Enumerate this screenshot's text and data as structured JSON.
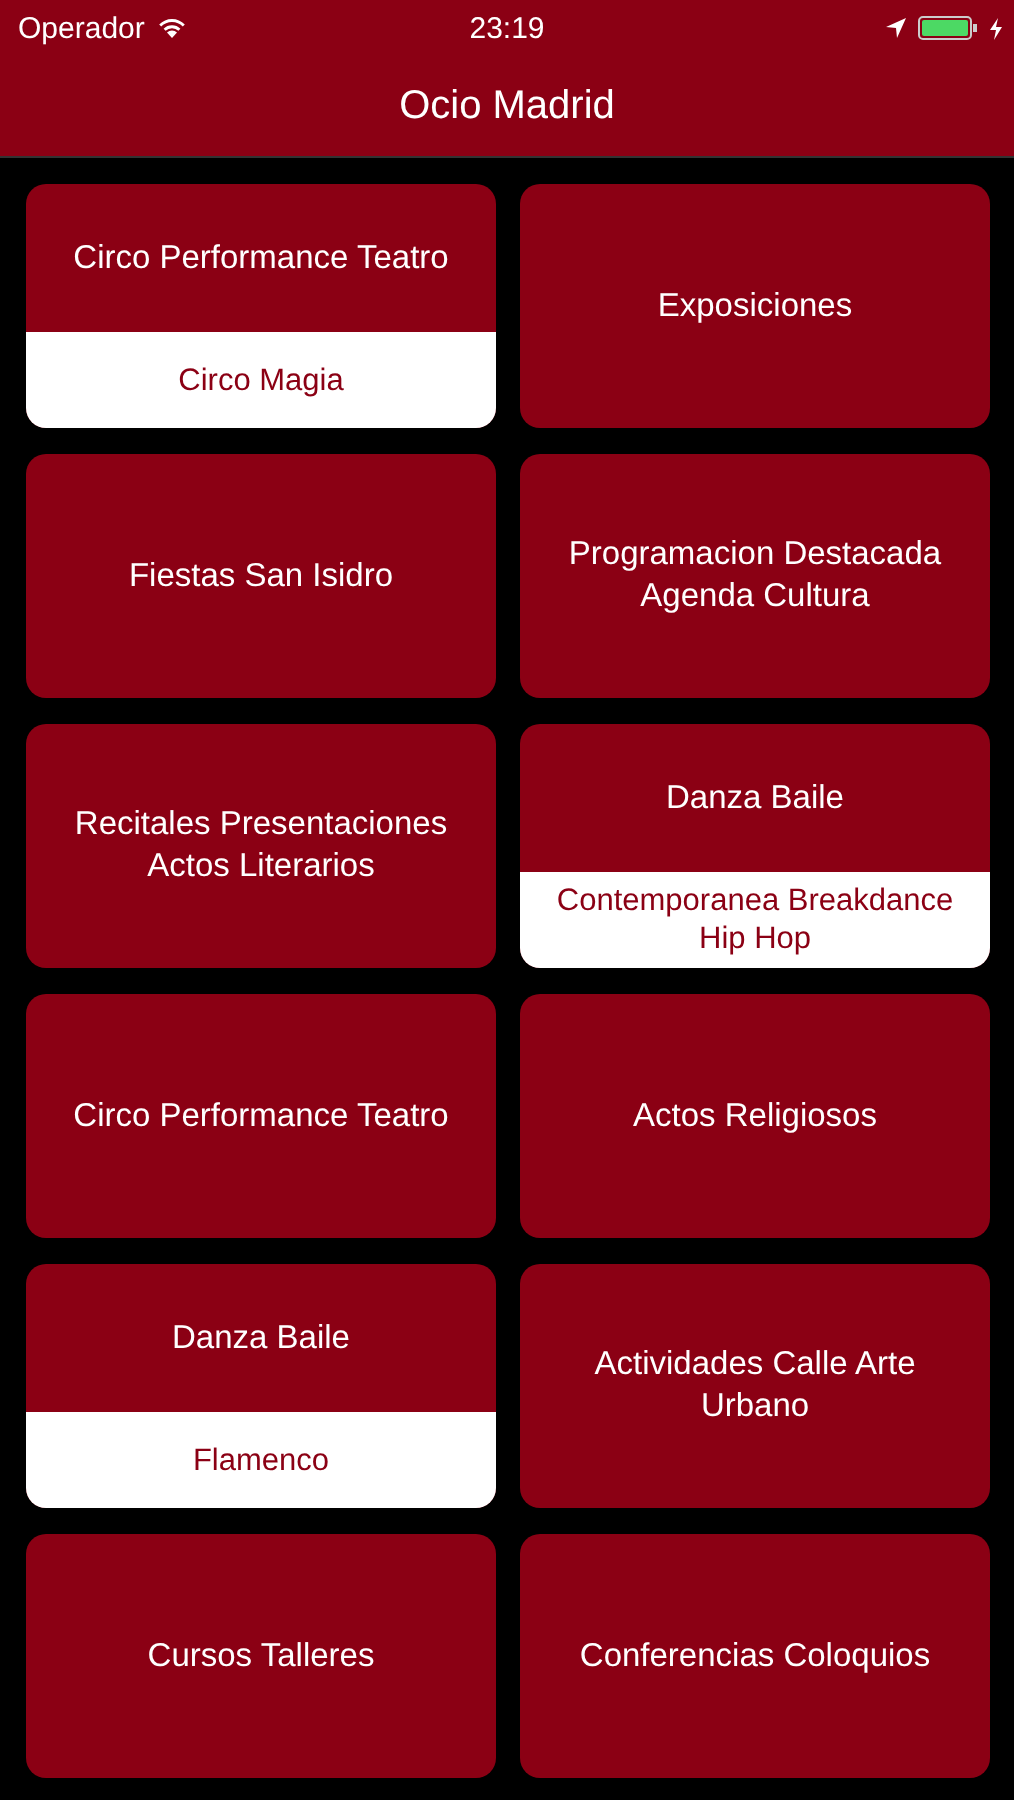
{
  "status_bar": {
    "carrier": "Operador",
    "time": "23:19",
    "battery_charging": true
  },
  "nav_bar": {
    "title": "Ocio Madrid"
  },
  "tile_rows": [
    {
      "tiles": [
        {
          "title": "Circo Performance Teatro",
          "subtitle": "Circo Magia"
        },
        {
          "title": "Exposiciones"
        }
      ]
    },
    {
      "tiles": [
        {
          "title": "Fiestas San Isidro"
        },
        {
          "title": "Programacion Destacada Agenda Cultura"
        }
      ]
    },
    {
      "tiles": [
        {
          "title": "Recitales Presentaciones Actos Literarios"
        },
        {
          "title": "Danza Baile",
          "subtitle": "Contemporanea Breakdance Hip Hop"
        }
      ]
    },
    {
      "tiles": [
        {
          "title": "Circo Performance Teatro"
        },
        {
          "title": "Actos Religiosos"
        }
      ]
    },
    {
      "tiles": [
        {
          "title": "Danza Baile",
          "subtitle": "Flamenco"
        },
        {
          "title": "Actividades Calle Arte Urbano"
        }
      ]
    },
    {
      "tiles": [
        {
          "title": "Cursos Talleres"
        },
        {
          "title": "Conferencias Coloquios"
        }
      ]
    }
  ]
}
